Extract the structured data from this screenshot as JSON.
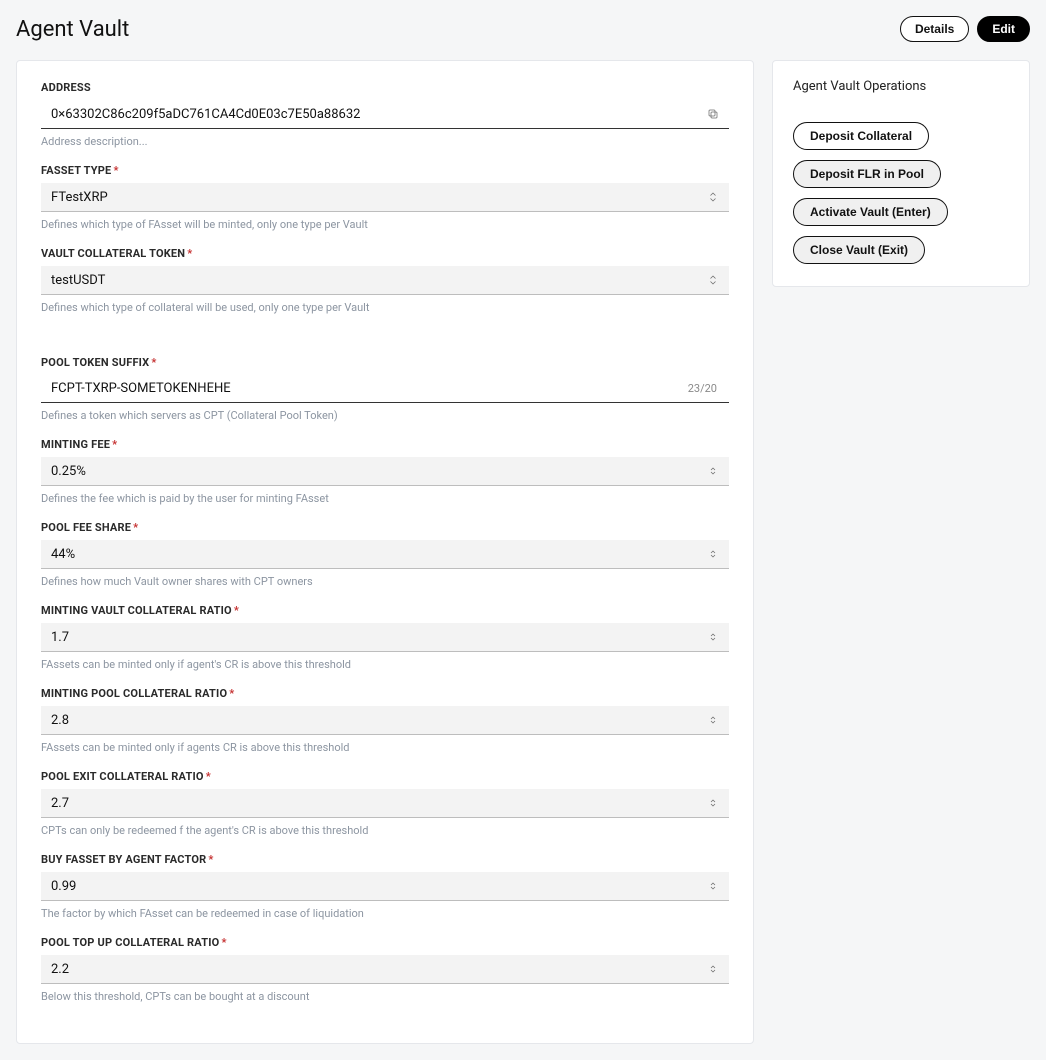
{
  "page_title": "Agent Vault",
  "header_buttons": {
    "details": "Details",
    "edit": "Edit"
  },
  "sidebar": {
    "title": "Agent Vault Operations",
    "buttons": {
      "deposit_collateral": "Deposit Collateral",
      "deposit_flr": "Deposit FLR in Pool",
      "activate": "Activate Vault (Enter)",
      "close": "Close Vault (Exit)"
    }
  },
  "fields": {
    "address": {
      "label": "ADDRESS",
      "value": "0×63302C86c209f5aDC761CA4Cd0E03c7E50a88632",
      "desc": "Address description..."
    },
    "fasset_type": {
      "label": "FASSET TYPE",
      "value": "FTestXRP",
      "desc": "Defines which type of FAsset will be minted, only one type per Vault"
    },
    "vault_collateral_token": {
      "label": "VAULT COLLATERAL TOKEN",
      "value": "testUSDT",
      "desc": "Defines which type of collateral will be used, only one type per Vault"
    },
    "pool_token_suffix": {
      "label": "POOL TOKEN SUFFIX",
      "value": "FCPT-TXRP-SOMETOKENHEHE",
      "counter": "23/20",
      "desc": "Defines a token which servers as CPT (Collateral Pool Token)"
    },
    "minting_fee": {
      "label": "MINTING FEE",
      "value": "0.25%",
      "desc": "Defines the fee which is paid by the user for minting FAsset"
    },
    "pool_fee_share": {
      "label": "POOL FEE SHARE",
      "value": "44%",
      "desc": "Defines how much Vault owner shares with CPT owners"
    },
    "minting_vault_cr": {
      "label": "MINTING VAULT COLLATERAL RATIO",
      "value": "1.7",
      "desc": "FAssets can be minted only if agent's CR is above this threshold"
    },
    "minting_pool_cr": {
      "label": "MINTING POOL COLLATERAL RATIO",
      "value": "2.8",
      "desc": "FAssets can be minted only if agents CR is above this threshold"
    },
    "pool_exit_cr": {
      "label": "POOL EXIT COLLATERAL RATIO",
      "value": "2.7",
      "desc": "CPTs can only be redeemed f the agent's CR is above this threshold"
    },
    "buy_fasset_factor": {
      "label": "BUY FASSET BY AGENT FACTOR",
      "value": "0.99",
      "desc": "The factor by which FAsset can be redeemed in case of liquidation"
    },
    "pool_topup_cr": {
      "label": "POOL TOP UP COLLATERAL RATIO",
      "value": "2.2",
      "desc": "Below this threshold, CPTs can be bought at a discount"
    }
  }
}
